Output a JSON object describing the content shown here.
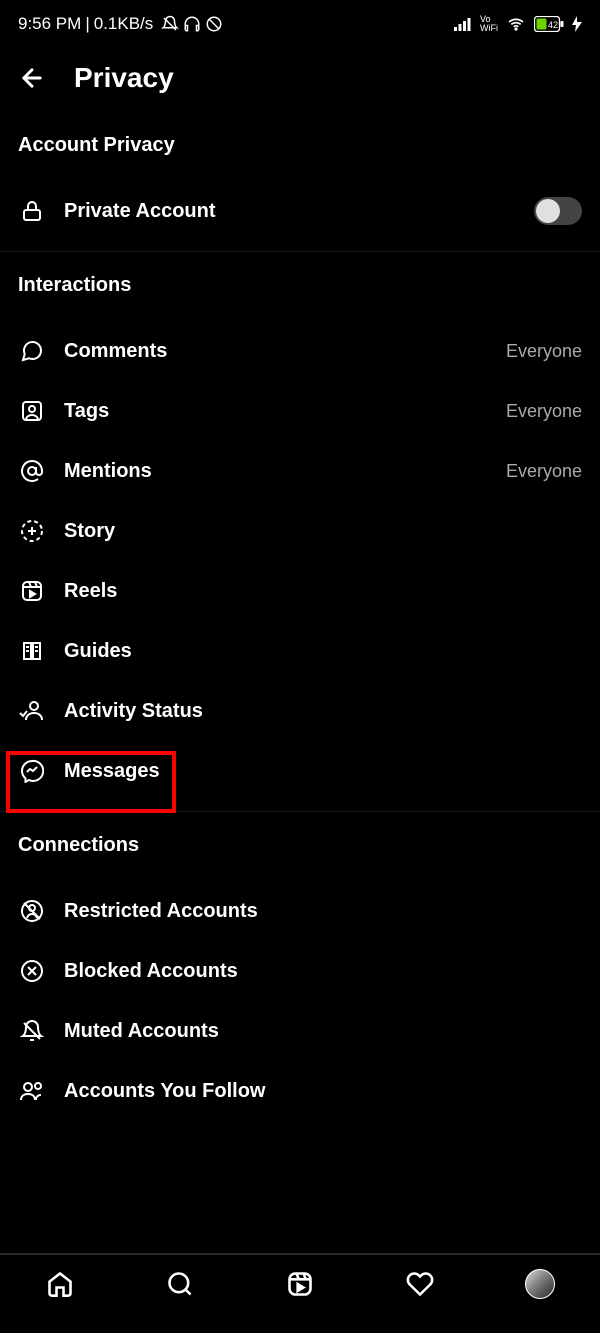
{
  "status": {
    "time": "9:56 PM",
    "net_speed": "0.1KB/s",
    "battery": "42"
  },
  "header": {
    "title": "Privacy"
  },
  "sections": {
    "account_privacy": {
      "title": "Account Privacy",
      "private_account": "Private Account"
    },
    "interactions": {
      "title": "Interactions",
      "comments": {
        "label": "Comments",
        "value": "Everyone"
      },
      "tags": {
        "label": "Tags",
        "value": "Everyone"
      },
      "mentions": {
        "label": "Mentions",
        "value": "Everyone"
      },
      "story": "Story",
      "reels": "Reels",
      "guides": "Guides",
      "activity_status": "Activity Status",
      "messages": "Messages"
    },
    "connections": {
      "title": "Connections",
      "restricted": "Restricted Accounts",
      "blocked": "Blocked Accounts",
      "muted": "Muted Accounts",
      "following": "Accounts You Follow"
    }
  }
}
